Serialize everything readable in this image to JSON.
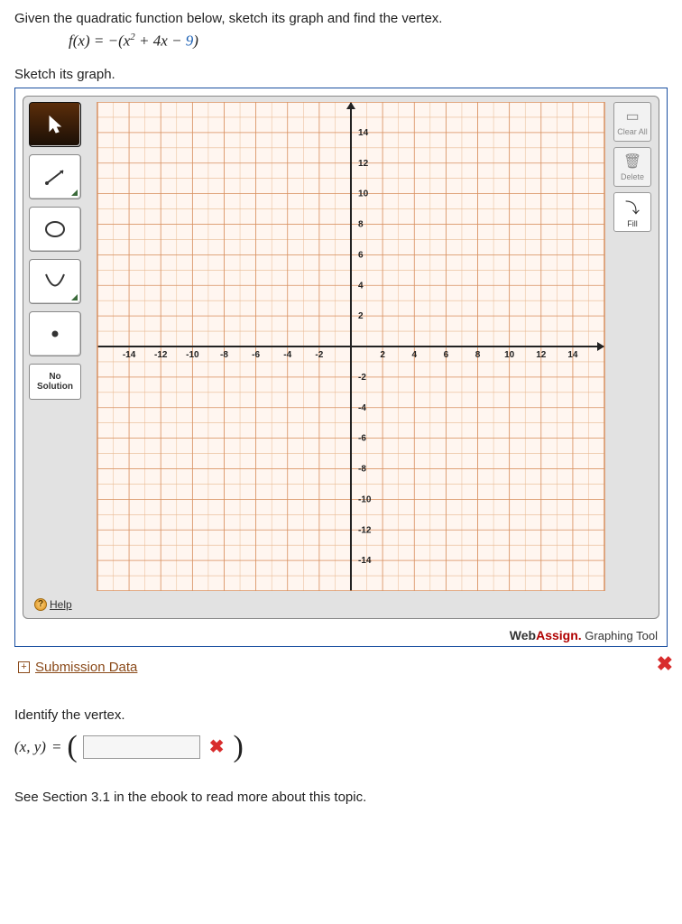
{
  "question": {
    "text1": "Given the quadratic function below, sketch its graph and find the vertex.",
    "fn_prefix": "f",
    "fn_arg": "x",
    "eq_text_pre": " = −(",
    "eq_term1": "x",
    "eq_exp": "2",
    "eq_text_mid": " + 4",
    "eq_term2": "x",
    "eq_text_mid2": " − ",
    "eq_constant": "9",
    "eq_text_post": ")"
  },
  "sketch": {
    "label": "Sketch its graph.",
    "no_solution": "No\nSolution",
    "help_label": "Help",
    "toolbar_right": {
      "clear_all": "Clear All",
      "delete": "Delete",
      "fill": "Fill"
    },
    "branding": {
      "web": "Web",
      "assign": "Assign.",
      "tool": " Graphing Tool"
    }
  },
  "chart_data": {
    "type": "scatter",
    "series": [],
    "xlim": [
      -16,
      16
    ],
    "ylim": [
      -16,
      16
    ],
    "xticks": [
      -14,
      -12,
      -10,
      -8,
      -6,
      -4,
      -2,
      2,
      4,
      6,
      8,
      10,
      12,
      14
    ],
    "yticks": [
      -14,
      -12,
      -10,
      -8,
      -6,
      -4,
      -2,
      2,
      4,
      6,
      8,
      10,
      12,
      14
    ],
    "grid": true,
    "title": "",
    "xlabel": "",
    "ylabel": ""
  },
  "submission": {
    "link": "Submission Data"
  },
  "vertex": {
    "heading": "Identify the vertex.",
    "lhs_open": "(",
    "lhs_x": "x",
    "lhs_sep": ", ",
    "lhs_y": "y",
    "lhs_close": ")",
    "equals": " = ",
    "value": ""
  },
  "footer": {
    "text": "See Section 3.1 in the ebook to read more about this topic."
  }
}
